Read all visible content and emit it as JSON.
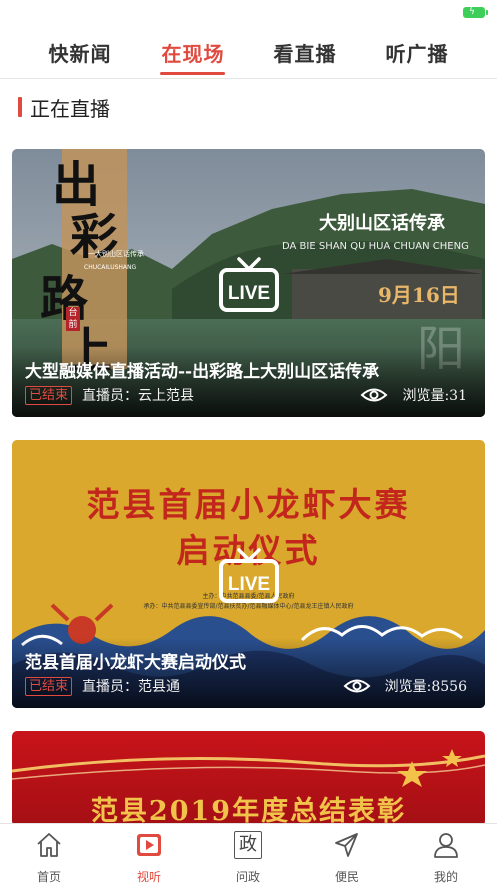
{
  "tabs": [
    {
      "label": "快新闻"
    },
    {
      "label": "在现场"
    },
    {
      "label": "看直播"
    },
    {
      "label": "听广播"
    }
  ],
  "active_tab": "在现场",
  "section": {
    "title": "正在直播"
  },
  "cards": [
    {
      "title": "大型融媒体直播活动--出彩路上大别山区话传承",
      "status": "已结束",
      "anchor": "直播员：云上范县",
      "views": "浏览量:31",
      "poster": {
        "calligraphy": [
          "出",
          "彩",
          "路",
          "上"
        ],
        "small_caption": "一大别山区话传承",
        "pinyin": "CHUCAILUSHANG",
        "seal": "台前",
        "headline": "大别山区话传承",
        "headline_pinyin": "DA BIE SHAN QU HUA CHUAN CHENG",
        "date": "9月16日",
        "faded": "阳"
      }
    },
    {
      "title": "范县首届小龙虾大赛启动仪式",
      "status": "已结束",
      "anchor": "直播员：范县通",
      "views": "浏览量:8556",
      "poster": {
        "headline_line1": "范县首届小龙虾大赛",
        "headline_line2": "启动仪式",
        "organizer": "主办：中共范县县委/范县人民政府",
        "co_organizer": "承办：中共范县县委宣传部/范县扶贫办/范县融媒体中心/范县龙王庄镇人民政府"
      }
    },
    {
      "poster": {
        "headline": "范县2019年度总结表彰"
      }
    }
  ],
  "live_icon": {
    "text": "LIVE"
  },
  "bottom_nav": [
    {
      "label": "首页",
      "icon": "home-icon"
    },
    {
      "label": "视听",
      "icon": "play-icon"
    },
    {
      "label": "问政",
      "icon": "zheng-icon",
      "glyph": "政"
    },
    {
      "label": "便民",
      "icon": "send-icon"
    },
    {
      "label": "我的",
      "icon": "user-icon"
    }
  ],
  "colors": {
    "accent": "#e04a3f",
    "live_green_battery": "#3ecf5a"
  }
}
